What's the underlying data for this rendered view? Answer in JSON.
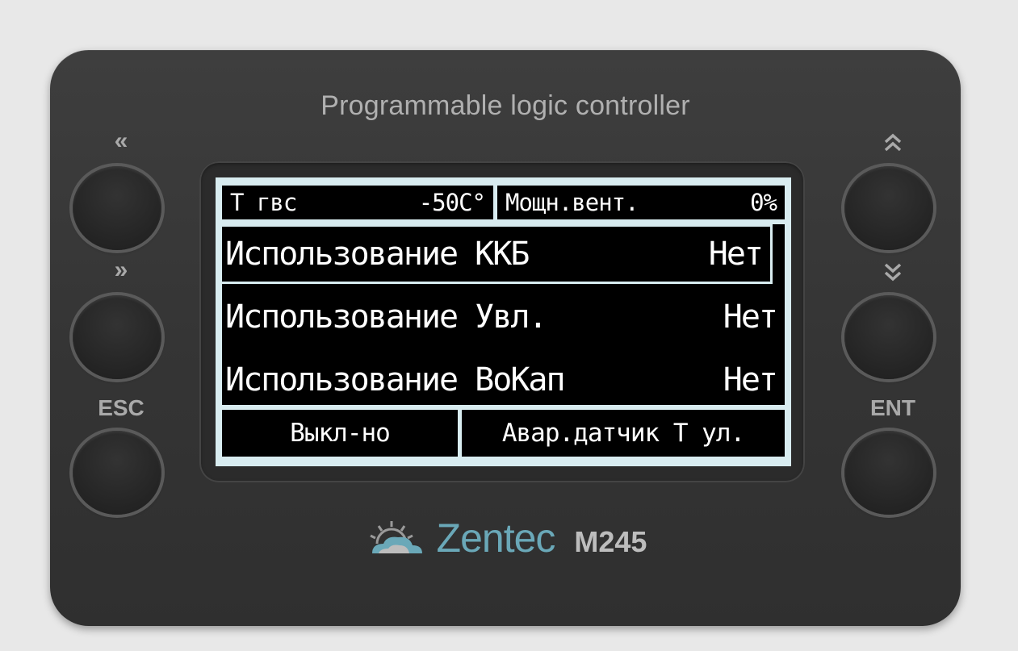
{
  "device": {
    "title": "Programmable logic controller",
    "brand": "Zentec",
    "model": "M245"
  },
  "buttons": {
    "left": [
      {
        "label": "«",
        "name": "prev-page"
      },
      {
        "label": "»",
        "name": "next-page"
      },
      {
        "label": "ESC",
        "name": "esc"
      }
    ],
    "right": [
      {
        "label": "⌃⌃",
        "name": "scroll-up"
      },
      {
        "label": "⌄⌄",
        "name": "scroll-down"
      },
      {
        "label": "ENT",
        "name": "enter"
      }
    ]
  },
  "screen": {
    "header": {
      "left_label": "Т гвс",
      "left_value": "-50С°",
      "right_label": "Мощн.вент.",
      "right_value": "0%"
    },
    "menu": [
      {
        "label": "Использование ККБ",
        "value": "Нет",
        "selected": true
      },
      {
        "label": "Использование Увл.",
        "value": "Нет",
        "selected": false
      },
      {
        "label": "Использование ВоКап",
        "value": "Нет",
        "selected": false
      }
    ],
    "footer": {
      "status": "Выкл-но",
      "alarm": "Авар.датчик Т ул."
    }
  },
  "colors": {
    "body": "#353535",
    "lcd_background": "#000000",
    "lcd_frame": "#d8ecf0",
    "brand": "#6aa8b8"
  }
}
